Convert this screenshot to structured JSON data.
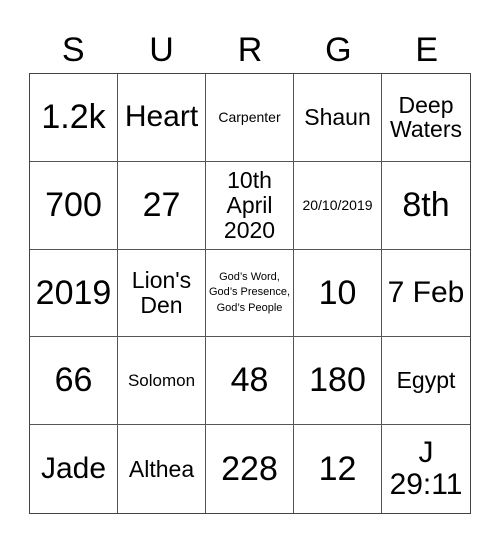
{
  "title_letters": [
    "S",
    "U",
    "R",
    "G",
    "E"
  ],
  "cells": [
    [
      "1.2k",
      "Heart",
      "Carpenter",
      "Shaun",
      "Deep Waters"
    ],
    [
      "700",
      "27",
      "10th April 2020",
      "20/10/2019",
      "8th"
    ],
    [
      "2019",
      "Lion's Den",
      "God’s Word, God’s Presence, God’s People",
      "10",
      "7 Feb"
    ],
    [
      "66",
      "Solomon",
      "48",
      "180",
      "Egypt"
    ],
    [
      "Jade",
      "Althea",
      "228",
      "12",
      "J 29:11"
    ]
  ]
}
